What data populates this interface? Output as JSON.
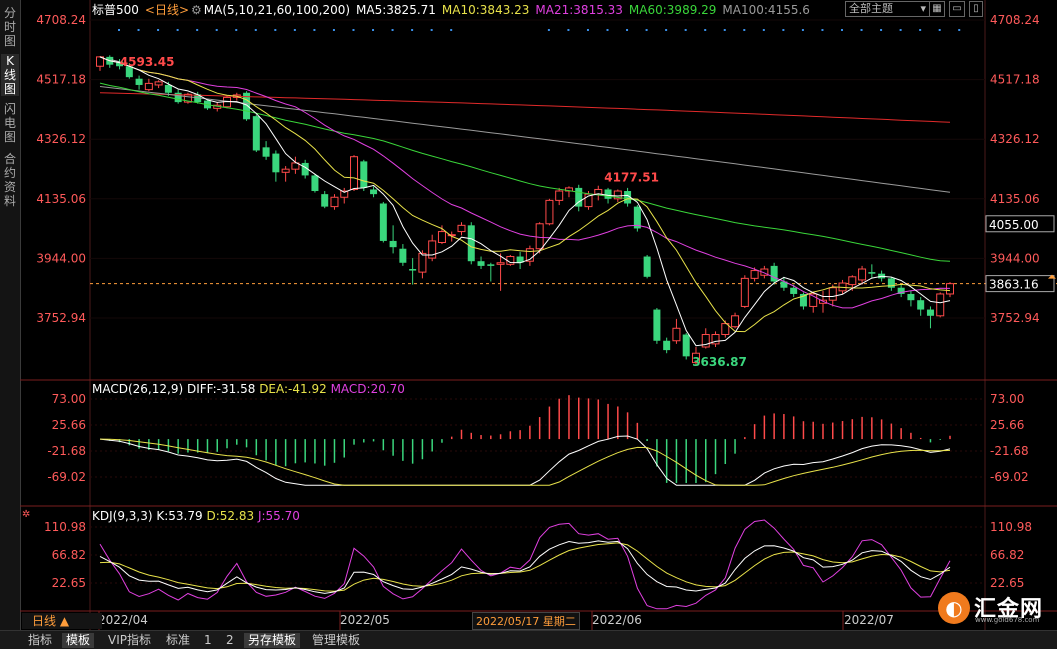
{
  "left_tabs": [
    "分时图",
    "K线图",
    "闪电图",
    "合约资料"
  ],
  "header": {
    "symbol": "标普500",
    "period_tag": "<日线>",
    "ma_params": "MA(5,10,21,60,100,200)",
    "ma5": "MA5:3825.71",
    "ma10": "MA10:3843.23",
    "ma21": "MA21:3815.33",
    "ma60": "MA60:3989.29",
    "ma100": "MA100:4155.6",
    "theme": "全部主题"
  },
  "colors": {
    "up": "#ff4a4a",
    "down": "#3ad67d",
    "ma5": "#ffffff",
    "ma10": "#e8e24a",
    "ma21": "#e040e0",
    "ma60": "#3ad63a",
    "ma100": "#9a9a9a",
    "ma200": "#e02a2a",
    "axis_text": "#ff5a5a",
    "price_line": "#ff9d3b"
  },
  "price_axis": {
    "ticks": [
      "4708.24",
      "4517.18",
      "4326.12",
      "4135.06",
      "3944.00",
      "3752.94"
    ],
    "tick_values": [
      4708.24,
      4517.18,
      4326.12,
      4135.06,
      3944.0,
      3752.94
    ],
    "cursor_label": "4055.00",
    "last_price_label": "3863.16",
    "high_label": "4593.45",
    "mid_high_label": "4177.51",
    "low_label": "3636.87"
  },
  "macd": {
    "title": "MACD(26,12,9)",
    "diff": "DIFF:-31.58",
    "dea": "DEA:-41.92",
    "macd": "MACD:20.70",
    "ticks": [
      "73.00",
      "25.66",
      "-21.68",
      "-69.02"
    ]
  },
  "kdj": {
    "title": "KDJ(9,3,3)",
    "k": "K:53.79",
    "d": "D:52.83",
    "j": "J:55.70",
    "ticks": [
      "110.98",
      "66.82",
      "22.65"
    ]
  },
  "date_labels": [
    "2022/04",
    "2022/05",
    "2022/05/17 星期二",
    "2022/06",
    "2022/07"
  ],
  "day_line_label": "日线 ▲",
  "bottom_tabs": [
    "指标",
    "模板",
    "VIP指标",
    "标准",
    "1",
    "2",
    "另存模板",
    "管理模板"
  ],
  "logo": {
    "name": "汇金网",
    "url": "www.gold678.com",
    "mark": "◐"
  },
  "chart_data": {
    "type": "candlestick",
    "y_range": [
      3680,
      4708.24
    ],
    "candles": [
      [
        4560,
        4590,
        4545,
        4593
      ],
      [
        4590,
        4565,
        4555,
        4595
      ],
      [
        4575,
        4560,
        4550,
        4583
      ],
      [
        4560,
        4525,
        4520,
        4570
      ],
      [
        4520,
        4500,
        4485,
        4530
      ],
      [
        4485,
        4505,
        4480,
        4520
      ],
      [
        4500,
        4510,
        4490,
        4515
      ],
      [
        4500,
        4475,
        4465,
        4510
      ],
      [
        4475,
        4445,
        4440,
        4485
      ],
      [
        4445,
        4470,
        4440,
        4475
      ],
      [
        4470,
        4445,
        4440,
        4478
      ],
      [
        4450,
        4425,
        4420,
        4455
      ],
      [
        4425,
        4435,
        4415,
        4445
      ],
      [
        4430,
        4460,
        4425,
        4465
      ],
      [
        4460,
        4468,
        4450,
        4475
      ],
      [
        4475,
        4390,
        4385,
        4480
      ],
      [
        4400,
        4290,
        4285,
        4405
      ],
      [
        4300,
        4270,
        4260,
        4320
      ],
      [
        4280,
        4220,
        4190,
        4290
      ],
      [
        4220,
        4230,
        4190,
        4240
      ],
      [
        4230,
        4250,
        4215,
        4270
      ],
      [
        4250,
        4210,
        4200,
        4260
      ],
      [
        4210,
        4160,
        4155,
        4215
      ],
      [
        4150,
        4110,
        4105,
        4160
      ],
      [
        4110,
        4140,
        4100,
        4150
      ],
      [
        4140,
        4160,
        4120,
        4170
      ],
      [
        4165,
        4270,
        4160,
        4275
      ],
      [
        4255,
        4170,
        4160,
        4260
      ],
      [
        4165,
        4150,
        4140,
        4175
      ],
      [
        4120,
        4000,
        3995,
        4125
      ],
      [
        4000,
        3980,
        3960,
        4050
      ],
      [
        3975,
        3930,
        3920,
        3990
      ],
      [
        3910,
        3905,
        3860,
        3945
      ],
      [
        3900,
        3960,
        3880,
        3970
      ],
      [
        3945,
        4000,
        3935,
        4020
      ],
      [
        3995,
        4030,
        3990,
        4050
      ],
      [
        4020,
        4020,
        3998,
        4030
      ],
      [
        4030,
        4050,
        4018,
        4060
      ],
      [
        4050,
        3935,
        3925,
        4060
      ],
      [
        3935,
        3920,
        3910,
        3950
      ],
      [
        3925,
        3920,
        3870,
        3930
      ],
      [
        3925,
        3930,
        3840,
        3960
      ],
      [
        3925,
        3950,
        3920,
        3955
      ],
      [
        3950,
        3930,
        3910,
        3965
      ],
      [
        3935,
        3975,
        3920,
        3985
      ],
      [
        3975,
        4055,
        3960,
        4060
      ],
      [
        4055,
        4130,
        4050,
        4135
      ],
      [
        4130,
        4160,
        4115,
        4170
      ],
      [
        4160,
        4170,
        4140,
        4175
      ],
      [
        4170,
        4110,
        4095,
        4180
      ],
      [
        4110,
        4150,
        4100,
        4160
      ],
      [
        4150,
        4165,
        4130,
        4177
      ],
      [
        4165,
        4135,
        4120,
        4170
      ],
      [
        4135,
        4160,
        4125,
        4165
      ],
      [
        4160,
        4120,
        4110,
        4170
      ],
      [
        4110,
        4040,
        4030,
        4115
      ],
      [
        3950,
        3885,
        3880,
        3955
      ],
      [
        3780,
        3680,
        3670,
        3785
      ],
      [
        3680,
        3650,
        3640,
        3690
      ],
      [
        3680,
        3720,
        3670,
        3750
      ],
      [
        3700,
        3630,
        3620,
        3705
      ],
      [
        3610,
        3640,
        3600,
        3660
      ],
      [
        3660,
        3700,
        3655,
        3720
      ],
      [
        3670,
        3700,
        3660,
        3710
      ],
      [
        3700,
        3735,
        3690,
        3745
      ],
      [
        3725,
        3760,
        3720,
        3770
      ],
      [
        3790,
        3880,
        3785,
        3890
      ],
      [
        3880,
        3905,
        3870,
        3915
      ],
      [
        3890,
        3910,
        3880,
        3920
      ],
      [
        3920,
        3870,
        3860,
        3930
      ],
      [
        3870,
        3850,
        3840,
        3885
      ],
      [
        3850,
        3830,
        3820,
        3860
      ],
      [
        3830,
        3790,
        3780,
        3835
      ],
      [
        3790,
        3830,
        3770,
        3835
      ],
      [
        3800,
        3810,
        3770,
        3840
      ],
      [
        3810,
        3850,
        3790,
        3860
      ],
      [
        3840,
        3865,
        3830,
        3875
      ],
      [
        3860,
        3885,
        3840,
        3890
      ],
      [
        3875,
        3910,
        3860,
        3920
      ],
      [
        3900,
        3895,
        3880,
        3925
      ],
      [
        3895,
        3880,
        3870,
        3905
      ],
      [
        3880,
        3850,
        3840,
        3885
      ],
      [
        3850,
        3830,
        3820,
        3860
      ],
      [
        3830,
        3810,
        3790,
        3840
      ],
      [
        3810,
        3780,
        3760,
        3820
      ],
      [
        3780,
        3760,
        3720,
        3790
      ],
      [
        3760,
        3830,
        3755,
        3835
      ],
      [
        3830,
        3863,
        3820,
        3868
      ]
    ],
    "ma200": [
      4475,
      4380
    ],
    "ma100": [
      4495,
      4155.6
    ],
    "ma60": [
      4470,
      3989.29
    ],
    "macd_range": [
      -85,
      85
    ],
    "kdj_range": [
      -20,
      125
    ]
  }
}
